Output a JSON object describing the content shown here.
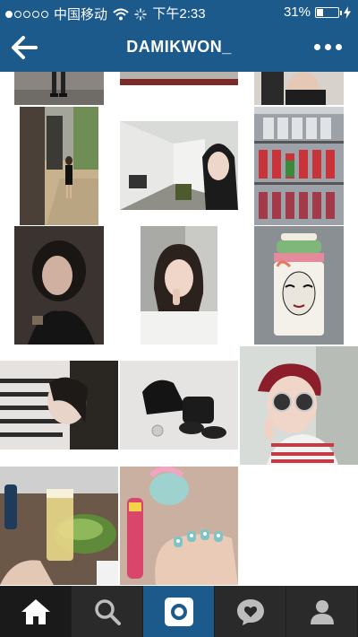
{
  "status_bar": {
    "carrier": "中国移动",
    "time": "下午2:33",
    "battery": "31%",
    "battery_level": 0.31,
    "signal_bars_on": 1,
    "signal_bars_total": 5
  },
  "header": {
    "title": "DAMIKWON_",
    "back_icon": "arrow-left-icon",
    "more_icon": "ellipsis-icon"
  },
  "colors": {
    "brand_blue": "#1d5a8c",
    "tab_bar": "#2a2a2a"
  },
  "grid": {
    "photos": [
      {
        "name": "street-legs"
      },
      {
        "name": "shoes-floor"
      },
      {
        "name": "woman-black-top"
      },
      {
        "name": "street-walk"
      },
      {
        "name": "selfie-hallway"
      },
      {
        "name": "fridge-drinks"
      },
      {
        "name": "selfie-dark"
      },
      {
        "name": "selfie-hand-chin"
      },
      {
        "name": "face-vase"
      },
      {
        "name": "striped-shirt-selfie"
      },
      {
        "name": "black-bag-shoes"
      },
      {
        "name": "sunglasses-cap-selfie"
      },
      {
        "name": "beer-salad"
      },
      {
        "name": "nails-pony"
      }
    ]
  },
  "tab_bar": {
    "tabs": [
      {
        "name": "home",
        "icon": "home-icon"
      },
      {
        "name": "explore",
        "icon": "search-icon"
      },
      {
        "name": "camera",
        "icon": "camera-icon"
      },
      {
        "name": "activity",
        "icon": "heart-bubble-icon"
      },
      {
        "name": "profile",
        "icon": "profile-icon"
      }
    ]
  }
}
